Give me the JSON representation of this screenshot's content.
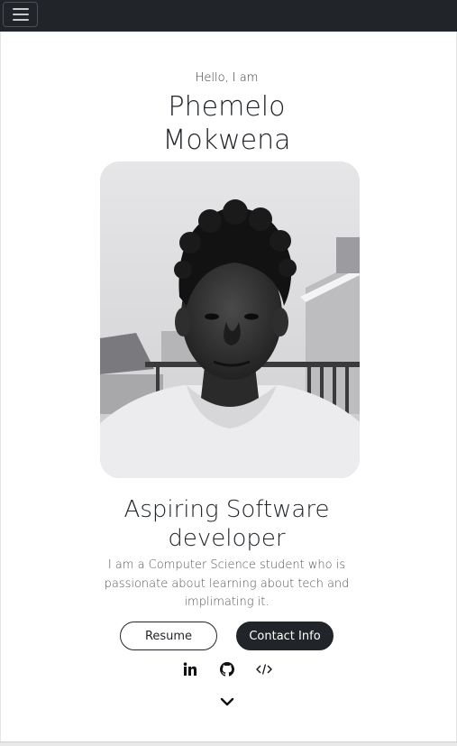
{
  "nav": {
    "toggle_icon": "hamburger-menu-icon"
  },
  "hero": {
    "greeting": "Hello, I am",
    "name_line1": "Phemelo",
    "name_line2": "Mokwena",
    "photo_icon": "profile-photo"
  },
  "about": {
    "title_line1": "Aspiring Software",
    "title_line2": "developer",
    "description": "I am a Computer Science student who is passionate about learning about tech and implimating it."
  },
  "buttons": {
    "resume": "Resume",
    "contact": "Contact Info"
  },
  "socials": {
    "icons": [
      "linkedin-icon",
      "github-icon",
      "code-icon"
    ]
  },
  "scroll": {
    "icon": "chevron-down-icon"
  },
  "colors": {
    "navbar": "#212529",
    "dark_button": "#212529",
    "text": "#212529"
  }
}
